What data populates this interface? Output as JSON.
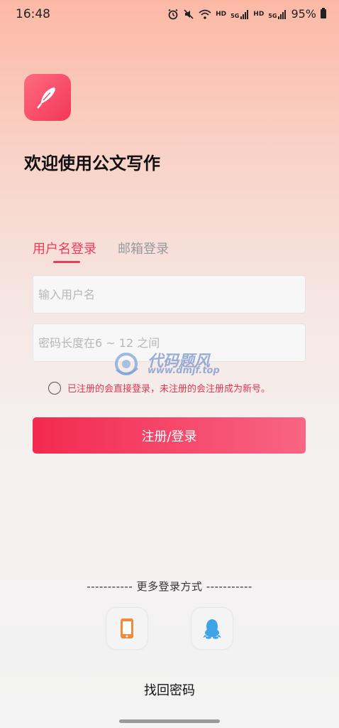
{
  "status_bar": {
    "time": "16:48",
    "hd1": "HD",
    "net1": "5G",
    "hd2": "HD",
    "net2": "5G",
    "battery": "95%"
  },
  "app": {
    "logo_icon": "feather-icon",
    "welcome": "欢迎使用公文写作"
  },
  "tabs": [
    {
      "label": "用户名登录",
      "active": true
    },
    {
      "label": "邮箱登录",
      "active": false
    }
  ],
  "form": {
    "username_placeholder": "输入用户名",
    "username_value": "",
    "password_placeholder": "密码长度在6 ~ 12 之间",
    "password_value": "",
    "agreement_text": "已注册的会直接登录，未注册的会注册成为新号。",
    "submit_label": "注册/登录"
  },
  "watermark": {
    "name": "代码题风",
    "url": "www.dmjf.top"
  },
  "footer": {
    "more_login": "----------- 更多登录方式 -----------",
    "social": [
      {
        "name": "phone-icon"
      },
      {
        "name": "qq-penguin-icon"
      }
    ],
    "find_password": "找回密码"
  },
  "colors": {
    "accent": "#ef3a5a",
    "submit_start": "#f3294f",
    "submit_end": "#f86583",
    "phone_icon": "#f08a3c",
    "qq_icon": "#3ea3e8"
  }
}
